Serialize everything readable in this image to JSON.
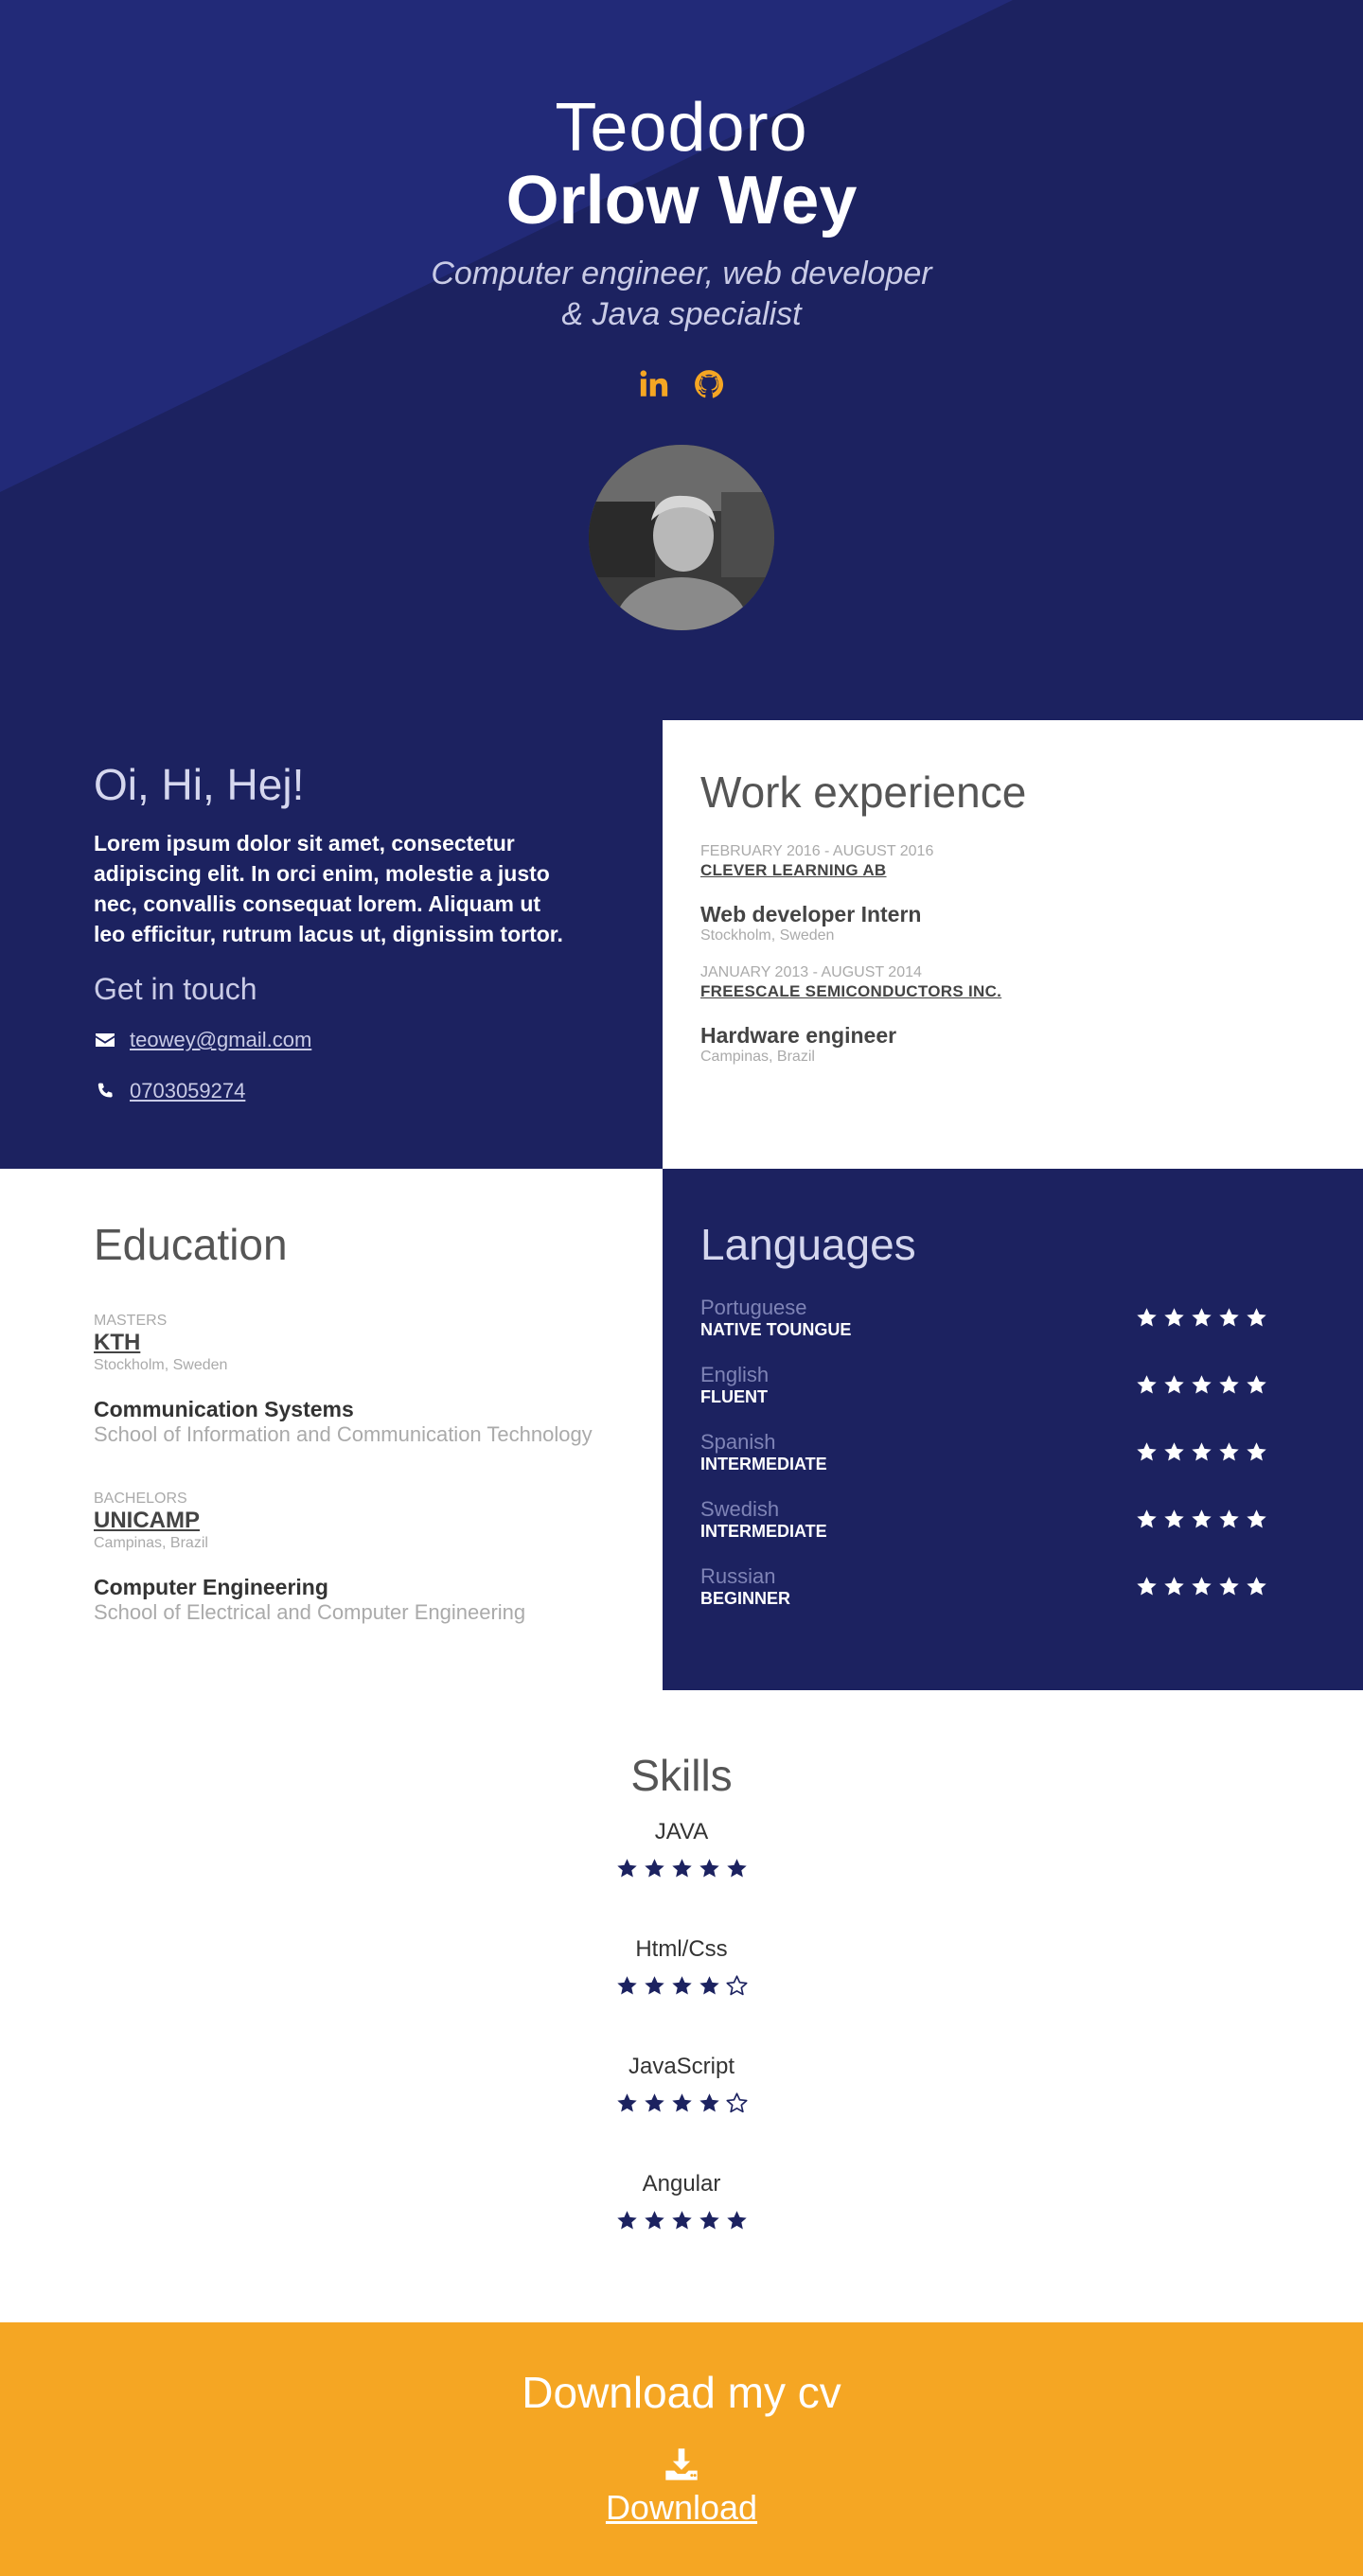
{
  "hero": {
    "first_name": "Teodoro",
    "last_name": "Orlow Wey",
    "tagline_line1": "Computer engineer, web developer",
    "tagline_line2": "& Java specialist",
    "socials": [
      "linkedin-icon",
      "github-icon"
    ],
    "avatar_alt": "Profile photo"
  },
  "intro": {
    "title": "Oi, Hi, Hej!",
    "text": "Lorem ipsum dolor sit amet, consectetur adipiscing elit. In orci enim, molestie a justo nec, convallis consequat lorem. Aliquam ut leo efficitur, rutrum lacus ut, dignissim tortor.",
    "touch_title": "Get in touch",
    "email": "teowey@gmail.com",
    "phone": "0703059274"
  },
  "work": {
    "title": "Work experience",
    "jobs": [
      {
        "date": "FEBRUARY 2016 - AUGUST 2016",
        "company": "CLEVER LEARNING AB",
        "role": "Web developer Intern",
        "place": "Stockholm, Sweden"
      },
      {
        "date": "JANUARY 2013 - AUGUST 2014",
        "company": "FREESCALE SEMICONDUCTORS INC.",
        "role": "Hardware engineer",
        "place": "Campinas, Brazil"
      }
    ]
  },
  "education": {
    "title": "Education",
    "items": [
      {
        "degree": "MASTERS",
        "school": "KTH",
        "place": "Stockholm, Sweden",
        "program": "Communication Systems",
        "faculty": "School of Information and Communication Technology"
      },
      {
        "degree": "BACHELORS",
        "school": "UNICAMP",
        "place": "Campinas, Brazil",
        "program": "Computer Engineering",
        "faculty": "School of Electrical and Computer Engineering"
      }
    ]
  },
  "languages": {
    "title": "Languages",
    "items": [
      {
        "name": "Portuguese",
        "level": "NATIVE TOUNGUE",
        "stars": 5
      },
      {
        "name": "English",
        "level": "FLUENT",
        "stars": 5
      },
      {
        "name": "Spanish",
        "level": "INTERMEDIATE",
        "stars": 5
      },
      {
        "name": "Swedish",
        "level": "INTERMEDIATE",
        "stars": 5
      },
      {
        "name": "Russian",
        "level": "BEGINNER",
        "stars": 5
      }
    ]
  },
  "skills": {
    "title": "Skills",
    "items": [
      {
        "name": "JAVA",
        "stars": 5
      },
      {
        "name": "Html/Css",
        "stars": 4
      },
      {
        "name": "JavaScript",
        "stars": 4
      },
      {
        "name": "Angular",
        "stars": 5
      }
    ]
  },
  "download": {
    "title": "Download my cv",
    "link_label": "Download"
  },
  "colors": {
    "navy": "#1c2260",
    "accent": "#f5a623"
  }
}
